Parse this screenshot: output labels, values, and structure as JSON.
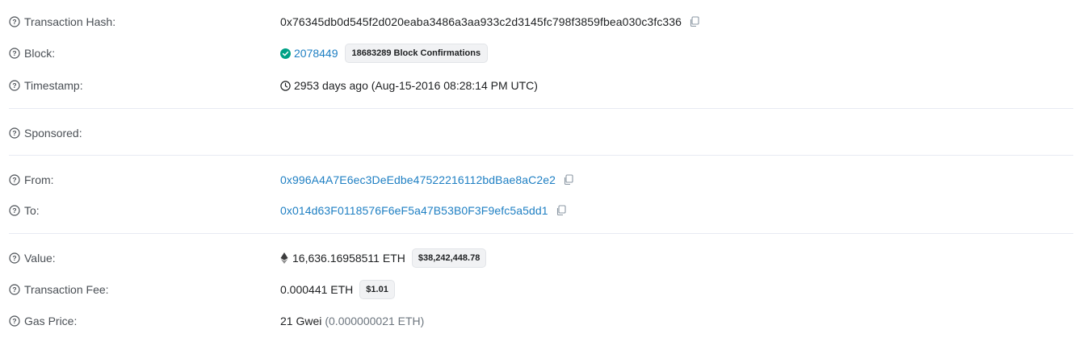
{
  "details": {
    "tx_hash": {
      "label": "Transaction Hash:",
      "value": "0x76345db0d545f2d020eaba3486a3aa933c2d3145fc798f3859fbea030c3fc336"
    },
    "block": {
      "label": "Block:",
      "number": "2078449",
      "confirmations": "18683289 Block Confirmations"
    },
    "timestamp": {
      "label": "Timestamp:",
      "value": "2953 days ago (Aug-15-2016 08:28:14 PM UTC)"
    },
    "sponsored": {
      "label": "Sponsored:"
    },
    "from": {
      "label": "From:",
      "address": "0x996A4A7E6ec3DeEdbe47522216112bdBae8aC2e2"
    },
    "to": {
      "label": "To:",
      "address": "0x014d63F0118576F6eF5a47B53B0F3F9efc5a5dd1"
    },
    "value": {
      "label": "Value:",
      "amount": "16,636.16958511 ETH",
      "usd": "$38,242,448.78"
    },
    "fee": {
      "label": "Transaction Fee:",
      "amount": "0.000441 ETH",
      "usd": "$1.01"
    },
    "gas_price": {
      "label": "Gas Price:",
      "gwei": "21 Gwei",
      "eth": "(0.000000021 ETH)"
    }
  },
  "colors": {
    "link": "#1e7fc3",
    "success": "#00a186",
    "label": "#4a4f55",
    "divider": "#e7eaf3"
  },
  "icons": {
    "help": "question-circle-icon",
    "copy": "copy-icon",
    "success": "check-circle-icon",
    "clock": "clock-icon",
    "eth": "ethereum-icon"
  }
}
